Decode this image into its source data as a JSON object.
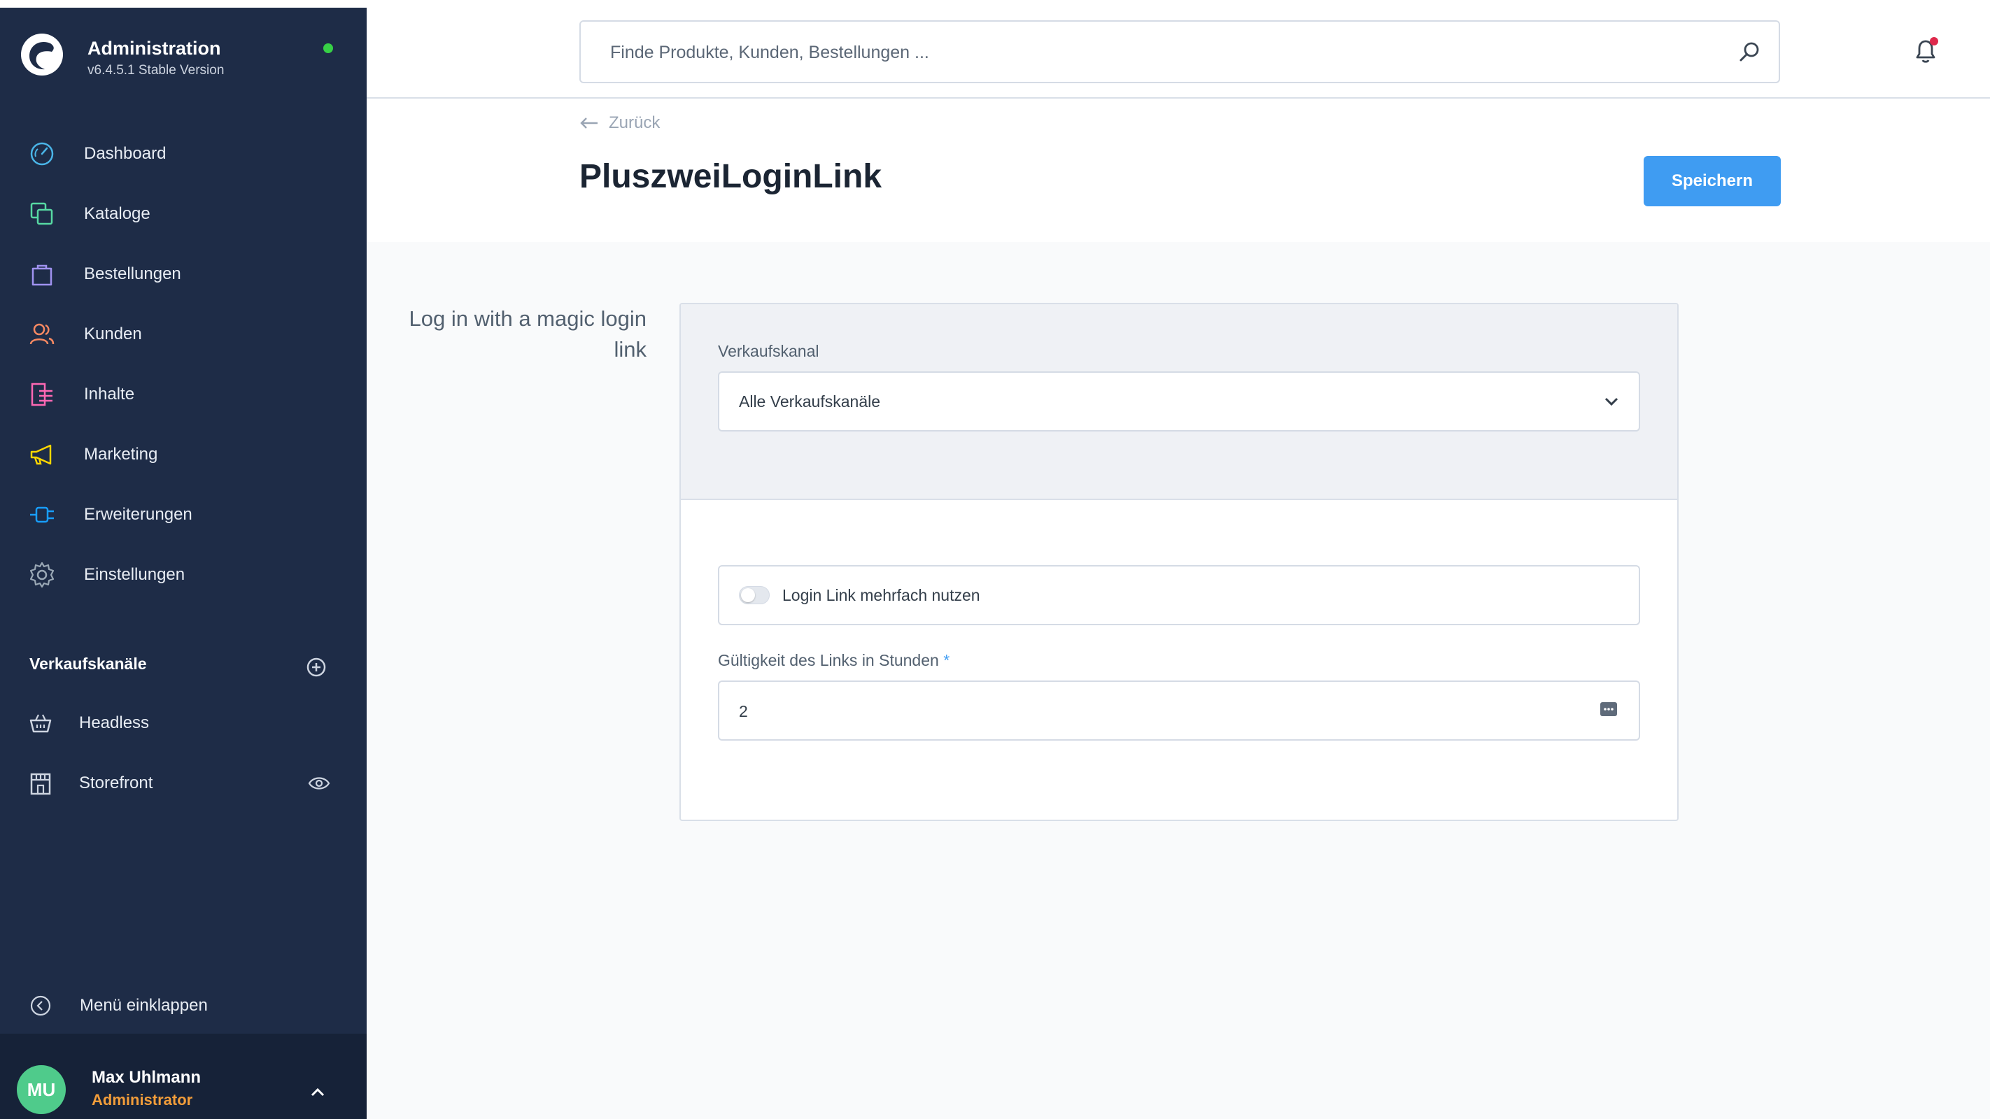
{
  "brand": {
    "title": "Administration",
    "version": "v6.4.5.1 Stable Version",
    "status_color": "#37d046"
  },
  "nav": {
    "items": [
      {
        "label": "Dashboard",
        "icon": "dashboard-icon",
        "color": "#4ab5e8"
      },
      {
        "label": "Kataloge",
        "icon": "catalog-icon",
        "color": "#57d9a3"
      },
      {
        "label": "Bestellungen",
        "icon": "shopping-bag-icon",
        "color": "#a092f0"
      },
      {
        "label": "Kunden",
        "icon": "customers-icon",
        "color": "#f88962"
      },
      {
        "label": "Inhalte",
        "icon": "content-icon",
        "color": "#ff68b4"
      },
      {
        "label": "Marketing",
        "icon": "megaphone-icon",
        "color": "#ffd700"
      },
      {
        "label": "Erweiterungen",
        "icon": "plug-icon",
        "color": "#189eff"
      },
      {
        "label": "Einstellungen",
        "icon": "gear-icon",
        "color": "#9aa8b5"
      }
    ]
  },
  "sales_channels": {
    "title": "Verkaufskanäle",
    "items": [
      {
        "label": "Headless",
        "icon": "basket-icon"
      },
      {
        "label": "Storefront",
        "icon": "storefront-icon"
      }
    ]
  },
  "collapse": {
    "label": "Menü einklappen"
  },
  "user": {
    "initials": "MU",
    "name": "Max Uhlmann",
    "role": "Administrator"
  },
  "search": {
    "placeholder": "Finde Produkte, Kunden, Bestellungen ..."
  },
  "header": {
    "back_label": "Zurück",
    "title": "PluszweiLoginLink",
    "save_label": "Speichern"
  },
  "settings": {
    "section_label": "Log in with a magic login link",
    "sales_channel": {
      "label": "Verkaufskanal",
      "value": "Alle Verkaufskanäle"
    },
    "multi_use": {
      "label": "Login Link mehrfach nutzen",
      "enabled": false
    },
    "validity": {
      "label": "Gültigkeit des Links in Stunden",
      "required_marker": "*",
      "value": "2"
    }
  },
  "colors": {
    "sidebar": "#1e2c47",
    "accent": "#3f9cf2",
    "role": "#f29d3a",
    "avatar": "#4fcb8b",
    "notification_dot": "#de294c"
  }
}
